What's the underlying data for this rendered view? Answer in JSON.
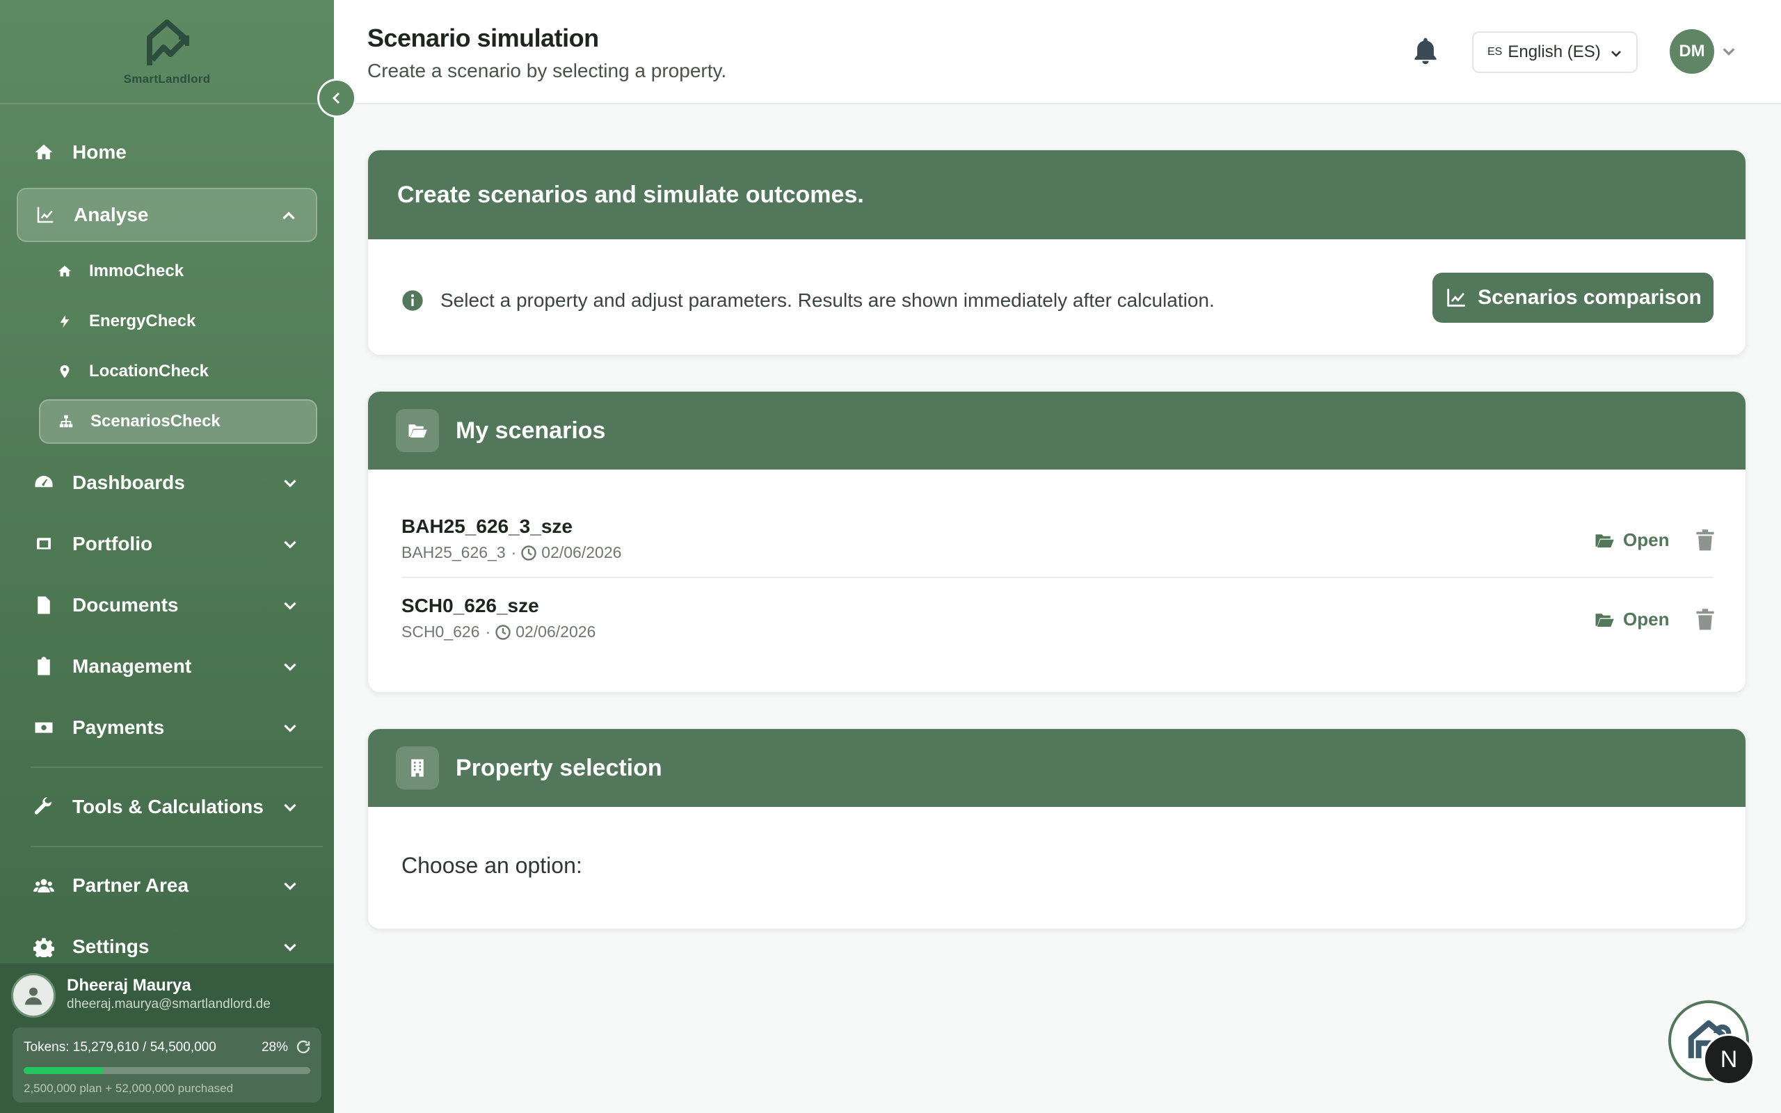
{
  "brand": {
    "name": "SmartLandlord"
  },
  "sidebar": {
    "items": [
      {
        "label": "Home",
        "icon": "home-icon"
      },
      {
        "label": "Analyse",
        "icon": "chart-line-icon",
        "expanded": true
      },
      {
        "label": "Dashboards",
        "icon": "gauge-icon"
      },
      {
        "label": "Portfolio",
        "icon": "portfolio-icon"
      },
      {
        "label": "Documents",
        "icon": "document-icon"
      },
      {
        "label": "Management",
        "icon": "clipboard-icon"
      },
      {
        "label": "Payments",
        "icon": "money-icon"
      },
      {
        "label": "Tools & Calculations",
        "icon": "wrench-icon"
      },
      {
        "label": "Partner Area",
        "icon": "users-icon"
      },
      {
        "label": "Settings",
        "icon": "gear-icon"
      }
    ],
    "analyse_sub": [
      {
        "label": "ImmoCheck",
        "icon": "home-icon"
      },
      {
        "label": "EnergyCheck",
        "icon": "bolt-icon"
      },
      {
        "label": "LocationCheck",
        "icon": "location-pin-icon"
      },
      {
        "label": "ScenariosCheck",
        "icon": "sitemap-icon",
        "active": true
      }
    ]
  },
  "user": {
    "name": "Dheeraj Maurya",
    "email": "dheeraj.maurya@smartlandlord.de",
    "initials": "DM"
  },
  "tokens": {
    "line": "Tokens: 15,279,610 / 54,500,000",
    "percent_label": "28%",
    "percent": 28,
    "sub": "2,500,000 plan + 52,000,000 purchased"
  },
  "header": {
    "title": "Scenario simulation",
    "subtitle": "Create a scenario by selecting a property.",
    "lang_code": "ES",
    "lang_label": "English (ES)"
  },
  "intro_card": {
    "title": "Create scenarios and simulate outcomes.",
    "info": "Select a property and adjust parameters. Results are shown immediately after calculation.",
    "compare_button": "Scenarios comparison"
  },
  "scenarios_card": {
    "title": "My scenarios",
    "open_label": "Open",
    "items": [
      {
        "name": "BAH25_626_3_sze",
        "property": "BAH25_626_3",
        "separator": "·",
        "date": "02/06/2026"
      },
      {
        "name": "SCH0_626_sze",
        "property": "SCH0_626",
        "separator": "·",
        "date": "02/06/2026"
      }
    ]
  },
  "property_card": {
    "title": "Property selection",
    "prompt": "Choose an option:"
  },
  "fab": {
    "badge": "N"
  },
  "colors": {
    "primary": "#52775a",
    "sidebar": "#4f7a55",
    "progress": "#22c55e"
  }
}
